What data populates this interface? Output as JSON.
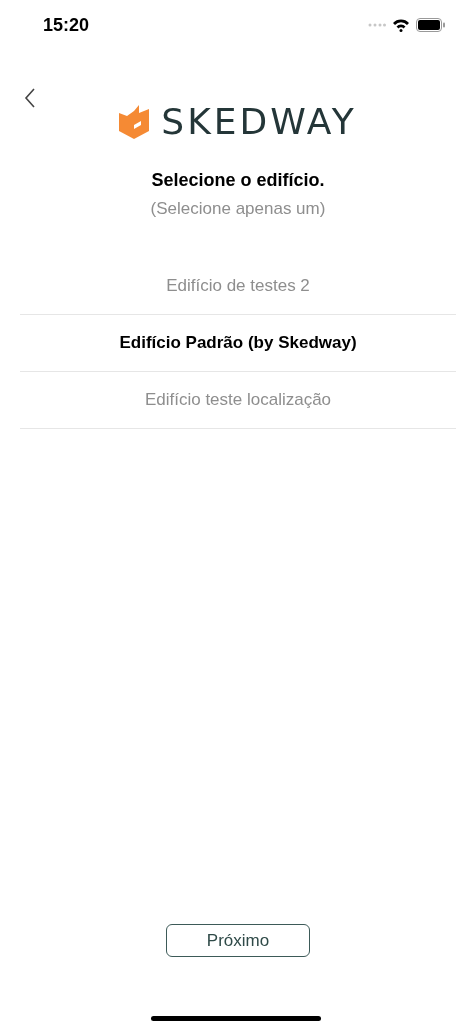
{
  "status_bar": {
    "time": "15:20"
  },
  "logo": {
    "text": "SKEDWAY"
  },
  "heading": {
    "title": "Selecione o edifício.",
    "subtitle": "(Selecione apenas um)"
  },
  "buildings": [
    {
      "label": "Edifício de testes 2",
      "selected": false
    },
    {
      "label": "Edifício Padrão (by Skedway)",
      "selected": true
    },
    {
      "label": "Edifício teste localização",
      "selected": false
    }
  ],
  "next_button": {
    "label": "Próximo"
  }
}
